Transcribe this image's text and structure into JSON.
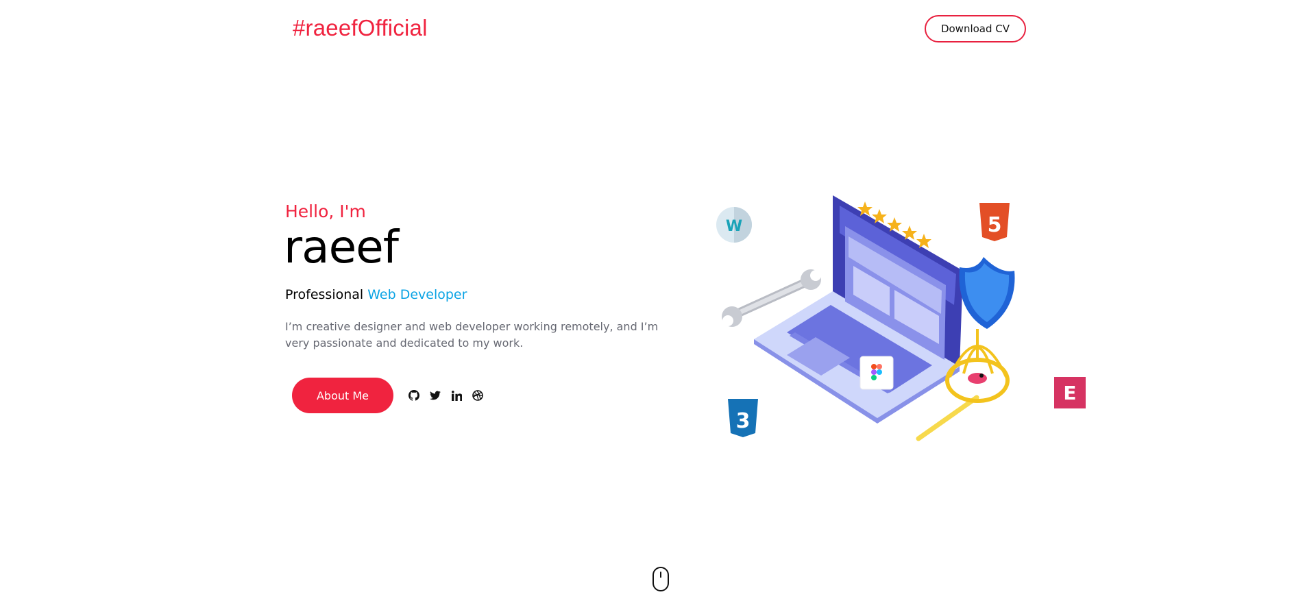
{
  "header": {
    "logo": "#raeefOfficial",
    "cv_label": "Download CV"
  },
  "hero": {
    "greeting": "Hello, I'm",
    "name": "raeef",
    "role_prefix": "Professional",
    "role_accent": "Web Developer",
    "description": "I’m creative designer and web developer working remotely, and I’m very passionate and dedicated to my work.",
    "about_label": "About Me"
  },
  "socials": [
    "github-icon",
    "twitter-icon",
    "linkedin-icon",
    "dribbble-icon"
  ],
  "illustration": {
    "badges": [
      "webflow-icon",
      "html5-icon",
      "css3-icon",
      "elementor-icon",
      "figma-icon"
    ],
    "html5_glyph": "5",
    "css3_glyph": "3",
    "elementor_glyph": "E",
    "webflow_glyph": "W"
  },
  "colors": {
    "accent": "#f0233f",
    "link": "#0aa3e4",
    "text_muted": "#666872",
    "laptop": "#4b4fd0"
  },
  "scroll_indicator": "mouse-scroll-icon"
}
